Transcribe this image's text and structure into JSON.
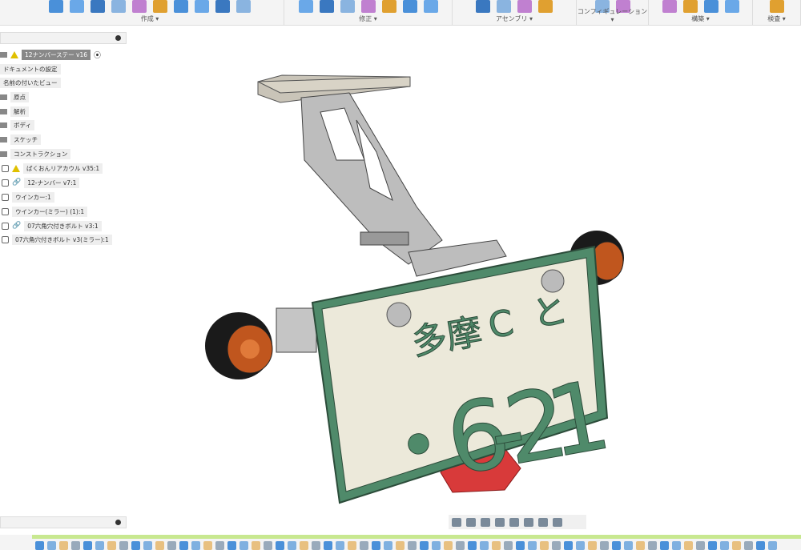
{
  "toolbar": {
    "groups": [
      {
        "label": "作成 ▾",
        "icons": [
          "sketch-icon",
          "extrude-icon",
          "box-icon",
          "revolve-icon",
          "pipe-icon",
          "point-icon",
          "pattern-icon",
          "pyramid-icon",
          "form-icon",
          "coil-icon"
        ]
      },
      {
        "label": "修正 ▾",
        "icons": [
          "press-pull-icon",
          "fillet-icon",
          "chamfer-icon",
          "shell-icon",
          "split-icon",
          "combine-icon",
          "move-icon"
        ]
      },
      {
        "label": "アセンブリ ▾",
        "icons": [
          "joint-icon",
          "new-component-icon",
          "rigid-group-icon",
          "table-icon"
        ]
      },
      {
        "label": "コンフィギュレーション ▾",
        "icons": [
          "configure-icon",
          "config-table-icon"
        ]
      },
      {
        "label": "構築 ▾",
        "icons": [
          "offset-plane-icon",
          "plane-angle-icon",
          "midplane-icon",
          "axis-icon"
        ]
      },
      {
        "label": "検査 ▾",
        "icons": [
          "measure-icon"
        ]
      }
    ]
  },
  "browser": {
    "items": [
      {
        "label": "12ナンバーステー v16",
        "type": "root"
      },
      {
        "label": "ドキュメントの設定",
        "type": "node"
      },
      {
        "label": "名前の付いたビュー",
        "type": "node"
      },
      {
        "label": "原点",
        "type": "folder"
      },
      {
        "label": "解析",
        "type": "folder"
      },
      {
        "label": "ボディ",
        "type": "folder"
      },
      {
        "label": "スケッチ",
        "type": "folder"
      },
      {
        "label": "コンストラクション",
        "type": "folder"
      },
      {
        "label": "ばくおんリアカウル v35:1",
        "type": "warn-comp"
      },
      {
        "label": "12-ナンバー v7:1",
        "type": "link-comp"
      },
      {
        "label": "ウインカー:1",
        "type": "comp"
      },
      {
        "label": "ウインカー(ミラー) (1):1",
        "type": "comp"
      },
      {
        "label": "07六角穴付きボルト v3:1",
        "type": "link-comp"
      },
      {
        "label": "07六角穴付きボルト v3(ミラー):1",
        "type": "comp"
      }
    ]
  },
  "plate": {
    "region": "多摩",
    "class": "C",
    "kana": "と",
    "number": "・6-21",
    "colors": {
      "frame": "#4f8a6a",
      "face": "#ece9da"
    }
  }
}
